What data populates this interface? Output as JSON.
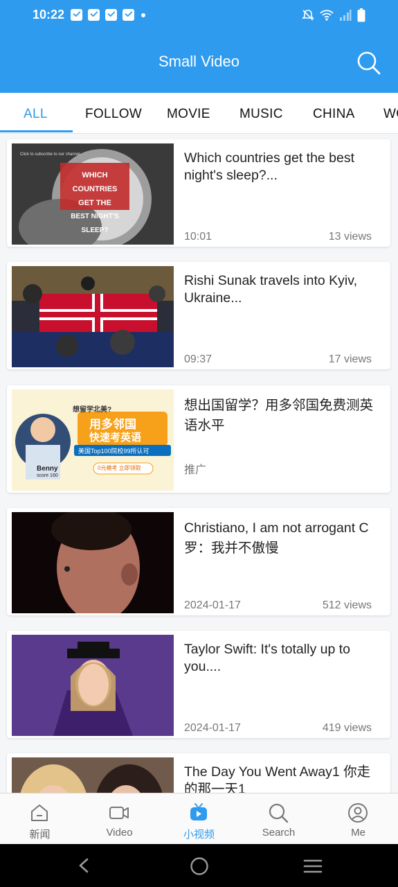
{
  "status": {
    "time": "10:22"
  },
  "header": {
    "title": "Small Video"
  },
  "tabs": [
    {
      "label": "ALL"
    },
    {
      "label": "FOLLOW"
    },
    {
      "label": "MOVIE"
    },
    {
      "label": "MUSIC"
    },
    {
      "label": "CHINA"
    },
    {
      "label": "WO"
    }
  ],
  "videos": [
    {
      "title": "Which countries get the best night's sleep?...",
      "date": "10:01",
      "views": "13 views",
      "thumb_text": [
        "WHICH COUNTRIES",
        "GET THE",
        "BEST NIGHT'S SLEEP?"
      ],
      "thumb_caption": "Click to subscribe to our channel"
    },
    {
      "title": "Rishi Sunak travels into Kyiv, Ukraine...",
      "date": "09:37",
      "views": "17 views"
    },
    {
      "title": "想出国留学？用多邻国免费测英语水平",
      "date": "推广",
      "views": "",
      "thumb_text": [
        "想留学北美?",
        "用多邻国",
        "快速考英语",
        "美国Top100院校99所认可",
        "0元模考 立即领取",
        "Benny",
        "score 160"
      ]
    },
    {
      "title": "Christiano, I am not arrogant C罗：我并不傲慢",
      "date": "2024-01-17",
      "views": "512 views"
    },
    {
      "title": "Taylor Swift: It's totally up to you....",
      "date": "2024-01-17",
      "views": "419 views"
    },
    {
      "title": "The Day You Went Away1 你走的那一天1",
      "date": "",
      "views": ""
    }
  ],
  "bottom_nav": [
    {
      "label": "新闻",
      "icon": "home-icon"
    },
    {
      "label": "Video",
      "icon": "video-camera-icon"
    },
    {
      "label": "小视频",
      "icon": "tv-play-icon"
    },
    {
      "label": "Search",
      "icon": "search-icon"
    },
    {
      "label": "Me",
      "icon": "person-icon"
    }
  ],
  "colors": {
    "accent": "#2f9bef",
    "nav_bar": "#000000"
  }
}
